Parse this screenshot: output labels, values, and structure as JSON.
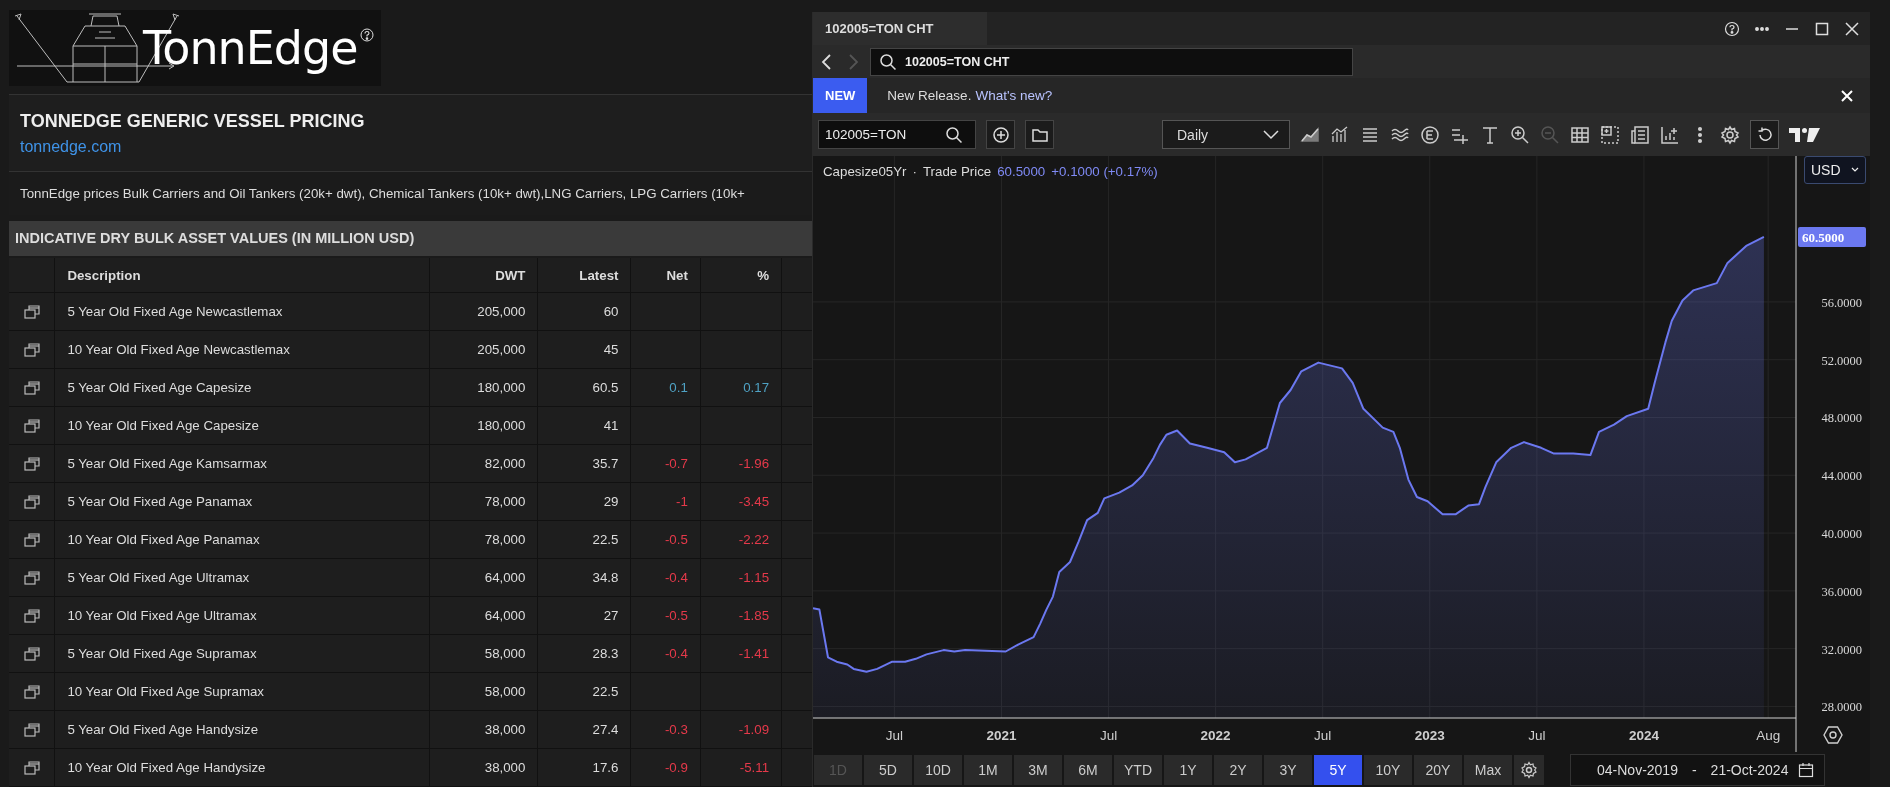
{
  "logo": {
    "text": "TonnEdge"
  },
  "header": {
    "title": "TONNEDGE GENERIC VESSEL PRICING",
    "link": "tonnedge.com"
  },
  "description": "TonnEdge prices Bulk Carriers and Oil Tankers (20k+ dwt), Chemical Tankers (10k+ dwt),LNG Carriers, LPG Carriers (10k+",
  "section_title": "INDICATIVE DRY BULK ASSET VALUES (IN MILLION USD)",
  "table": {
    "columns": [
      "Description",
      "DWT",
      "Latest",
      "Net",
      "%"
    ],
    "rows": [
      {
        "description": "5 Year Old Fixed Age Newcastlemax",
        "dwt": "205,000",
        "latest": "60"
      },
      {
        "description": "10 Year Old Fixed Age Newcastlemax",
        "dwt": "205,000",
        "latest": "45"
      },
      {
        "description": "5 Year Old Fixed Age Capesize",
        "dwt": "180,000",
        "latest": "60.5",
        "net": "0.1",
        "pct": "0.17",
        "color": "#4fa2c4"
      },
      {
        "description": "10 Year Old Fixed Age Capesize",
        "dwt": "180,000",
        "latest": "41"
      },
      {
        "description": "5 Year Old Fixed Age Kamsarmax",
        "dwt": "82,000",
        "latest": "35.7",
        "net": "-0.7",
        "pct": "-1.96",
        "color": "#e5394a"
      },
      {
        "description": "5 Year Old Fixed Age Panamax",
        "dwt": "78,000",
        "latest": "29",
        "net": "-1",
        "pct": "-3.45",
        "color": "#e5394a"
      },
      {
        "description": "10 Year Old Fixed Age Panamax",
        "dwt": "78,000",
        "latest": "22.5",
        "net": "-0.5",
        "pct": "-2.22",
        "color": "#e5394a"
      },
      {
        "description": "5 Year Old Fixed Age Ultramax",
        "dwt": "64,000",
        "latest": "34.8",
        "net": "-0.4",
        "pct": "-1.15",
        "color": "#e5394a"
      },
      {
        "description": "10 Year Old Fixed Age Ultramax",
        "dwt": "64,000",
        "latest": "27",
        "net": "-0.5",
        "pct": "-1.85",
        "color": "#e5394a"
      },
      {
        "description": "5 Year Old Fixed Age Supramax",
        "dwt": "58,000",
        "latest": "28.3",
        "net": "-0.4",
        "pct": "-1.41",
        "color": "#e5394a"
      },
      {
        "description": "10 Year Old Fixed Age Supramax",
        "dwt": "58,000",
        "latest": "22.5"
      },
      {
        "description": "5 Year Old Fixed Age Handysize",
        "dwt": "38,000",
        "latest": "27.4",
        "net": "-0.3",
        "pct": "-1.09",
        "color": "#e5394a"
      },
      {
        "description": "10 Year Old Fixed Age Handysize",
        "dwt": "38,000",
        "latest": "17.6",
        "net": "-0.9",
        "pct": "-5.11",
        "color": "#e5394a"
      }
    ]
  },
  "chart_window": {
    "title": "102005=TON CHT",
    "nav": {
      "back": {
        "disabled": false
      },
      "forward": {
        "disabled": true
      }
    },
    "search": {
      "value": "102005=TON CHT"
    },
    "notice": {
      "badge": "NEW",
      "text": "New Release.",
      "link": "What's new?"
    },
    "toolbar": {
      "ticker": "102005=TON",
      "interval": "Daily"
    },
    "legend": {
      "separator": "·",
      "field": "Trade Price",
      "price": "60.5000",
      "change": "+0.1000 (+0.17%)"
    },
    "currency": "USD",
    "last_price_label": "60.5000",
    "chart_data": {
      "type": "area",
      "grid": true,
      "xlim": [
        2020.12,
        2024.71
      ],
      "ylim": [
        27.2,
        66.1
      ],
      "xticks": [
        {
          "value": 2020.5,
          "label": "Jul"
        },
        {
          "value": 2021,
          "label": "2021"
        },
        {
          "value": 2021.5,
          "label": "Jul"
        },
        {
          "value": 2022,
          "label": "2022"
        },
        {
          "value": 2022.5,
          "label": "Jul"
        },
        {
          "value": 2023,
          "label": "2023"
        },
        {
          "value": 2023.5,
          "label": "Jul"
        },
        {
          "value": 2024,
          "label": "2024"
        },
        {
          "value": 2024.58,
          "label": "Aug"
        }
      ],
      "yticks": [
        {
          "value": 28,
          "label": "28.0000"
        },
        {
          "value": 32,
          "label": "32.0000"
        },
        {
          "value": 36,
          "label": "36.0000"
        },
        {
          "value": 40,
          "label": "40.0000"
        },
        {
          "value": 44,
          "label": "44.0000"
        },
        {
          "value": 48,
          "label": "48.0000"
        },
        {
          "value": 52,
          "label": "52.0000"
        },
        {
          "value": 56,
          "label": "56.0000"
        }
      ],
      "x": [
        2020.12,
        2020.15,
        2020.19,
        2020.23,
        2020.28,
        2020.31,
        2020.37,
        2020.42,
        2020.49,
        2020.55,
        2020.6,
        2020.65,
        2020.73,
        2020.78,
        2020.83,
        2021.02,
        2021.08,
        2021.15,
        2021.18,
        2021.21,
        2021.24,
        2021.27,
        2021.32,
        2021.36,
        2021.4,
        2021.45,
        2021.48,
        2021.55,
        2021.61,
        2021.66,
        2021.71,
        2021.74,
        2021.77,
        2021.82,
        2021.88,
        2021.96,
        2022.04,
        2022.09,
        2022.14,
        2022.24,
        2022.3,
        2022.35,
        2022.4,
        2022.48,
        2022.59,
        2022.64,
        2022.69,
        2022.78,
        2022.83,
        2022.86,
        2022.9,
        2022.94,
        2022.99,
        2023.06,
        2023.12,
        2023.18,
        2023.23,
        2023.26,
        2023.31,
        2023.38,
        2023.44,
        2023.52,
        2023.58,
        2023.67,
        2023.75,
        2023.79,
        2023.86,
        2023.92,
        2024.02,
        2024.05,
        2024.1,
        2024.13,
        2024.18,
        2024.23,
        2024.34,
        2024.39,
        2024.48,
        2024.56
      ],
      "series": [
        {
          "name": "Capesize05Yr",
          "color": "#6b78f0",
          "values": [
            34.8,
            34.7,
            31.4,
            31.1,
            30.9,
            30.6,
            30.4,
            30.6,
            31.1,
            31.1,
            31.3,
            31.6,
            31.9,
            31.8,
            31.9,
            31.8,
            32.3,
            32.8,
            33.7,
            34.7,
            35.6,
            37.3,
            38,
            39.4,
            40.9,
            41.4,
            42.4,
            42.8,
            43.3,
            44,
            45.2,
            46.1,
            46.8,
            47.1,
            46.2,
            45.9,
            45.6,
            44.9,
            45.1,
            45.9,
            49,
            49.9,
            51.2,
            51.8,
            51.4,
            50.4,
            48.6,
            47.3,
            47,
            45.9,
            43.7,
            42.5,
            42.2,
            41.3,
            41.3,
            41.9,
            42,
            43.2,
            44.9,
            45.9,
            46.3,
            45.9,
            45.5,
            45.5,
            45.4,
            47,
            47.5,
            48.1,
            48.6,
            50.4,
            53.2,
            54.7,
            56.1,
            56.8,
            57.3,
            58.7,
            59.9,
            60.5
          ]
        }
      ]
    },
    "ranges": [
      {
        "label": "1D",
        "selected": false,
        "disabled": true
      },
      {
        "label": "5D",
        "selected": false,
        "disabled": false
      },
      {
        "label": "10D",
        "selected": false,
        "disabled": false
      },
      {
        "label": "1M",
        "selected": false,
        "disabled": false
      },
      {
        "label": "3M",
        "selected": false,
        "disabled": false
      },
      {
        "label": "6M",
        "selected": false,
        "disabled": false
      },
      {
        "label": "YTD",
        "selected": false,
        "disabled": false
      },
      {
        "label": "1Y",
        "selected": false,
        "disabled": false
      },
      {
        "label": "2Y",
        "selected": false,
        "disabled": false
      },
      {
        "label": "3Y",
        "selected": false,
        "disabled": false
      },
      {
        "label": "5Y",
        "selected": true,
        "disabled": false
      },
      {
        "label": "10Y",
        "selected": false,
        "disabled": false
      },
      {
        "label": "20Y",
        "selected": false,
        "disabled": false
      },
      {
        "label": "Max",
        "selected": false,
        "disabled": false
      }
    ],
    "date_range": {
      "from": "04-Nov-2019",
      "separator": "-",
      "to": "21-Oct-2024"
    }
  }
}
